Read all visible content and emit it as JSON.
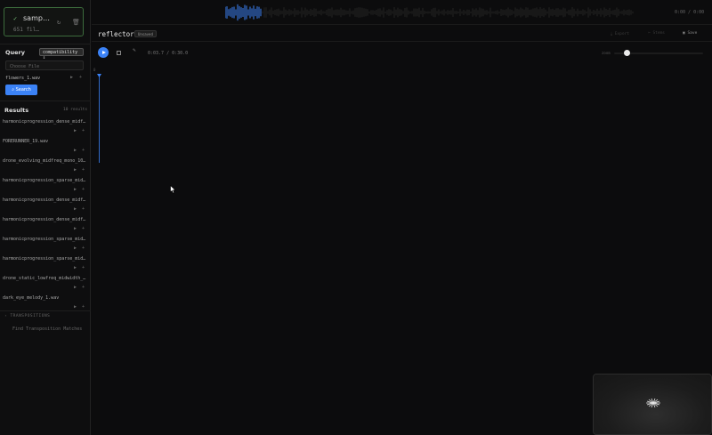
{
  "sample": {
    "name": "samp…",
    "count": "651 fil…"
  },
  "query": {
    "label": "Query",
    "mode": "compatibility",
    "choose_placeholder": "Choose File",
    "file": "flowers_1.wav",
    "search_label": "Search"
  },
  "results": {
    "label": "Results",
    "count": "10 results",
    "items": [
      {
        "name": "harmonicprogression_dense_midf…"
      },
      {
        "name": "FORERUNNER_19.wav"
      },
      {
        "name": "drone_evolving_midfreq_mono_10…"
      },
      {
        "name": "harmonicprogression_sparse_mid…"
      },
      {
        "name": "harmonicprogression_dense_midf…"
      },
      {
        "name": "harmonicprogression_dense_midf…"
      },
      {
        "name": "harmonicprogression_sparse_mid…"
      },
      {
        "name": "harmonicprogression_sparse_mid…"
      },
      {
        "name": "drone_static_lowfreq_midwidth_…"
      },
      {
        "name": "dark_eye_melody_1.wav"
      }
    ]
  },
  "transpositions": {
    "label": "TRANSPOSITIONS",
    "find_label": "Find Transposition Matches"
  },
  "topbar": {
    "time": "0:00 / 0:00"
  },
  "header": {
    "project_name": "reflector",
    "badge": "Unsaved",
    "export_label": "Export",
    "stems_label": "Stems",
    "save_label": "Save"
  },
  "transport": {
    "time": "0:03.7 / 0:30.0",
    "zoom_label": "zoom"
  },
  "timeline": {
    "marker": "0"
  },
  "colors": {
    "accent": "#3b82f6",
    "success": "#7bc47b",
    "background": "#0c0c0d"
  },
  "icons": {
    "check": "check-icon",
    "refresh": "refresh-icon",
    "trash": "trash-icon",
    "play": "play-icon",
    "plus": "plus-icon",
    "search": "search-icon",
    "stop": "stop-icon",
    "tool": "pencil-icon",
    "export": "download-icon",
    "stems": "scissors-icon",
    "save": "save-icon"
  }
}
